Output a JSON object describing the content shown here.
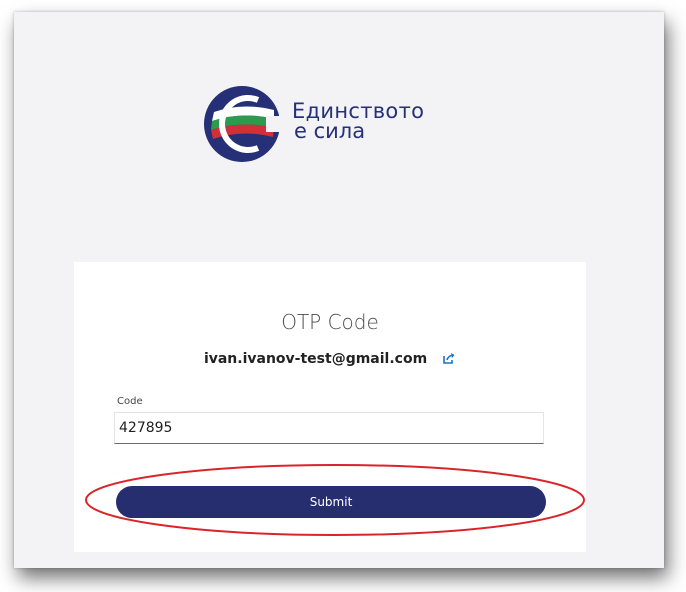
{
  "logo": {
    "line1": "Единството",
    "line2": "е сила",
    "colors": {
      "primary": "#263077",
      "flag_white": "#ffffff",
      "flag_green": "#2e9a4e",
      "flag_red": "#d0303a"
    }
  },
  "card": {
    "title": "OTP Code",
    "email": "ivan.ivanov-test@gmail.com",
    "edit_icon": "external-edit-icon",
    "code_label": "Code",
    "code_value": "427895",
    "submit_label": "Submit"
  },
  "annotation": {
    "color": "#d9252a",
    "shape": "ellipse"
  },
  "theme": {
    "button_bg": "#262e70",
    "link_blue": "#1a73c9"
  }
}
